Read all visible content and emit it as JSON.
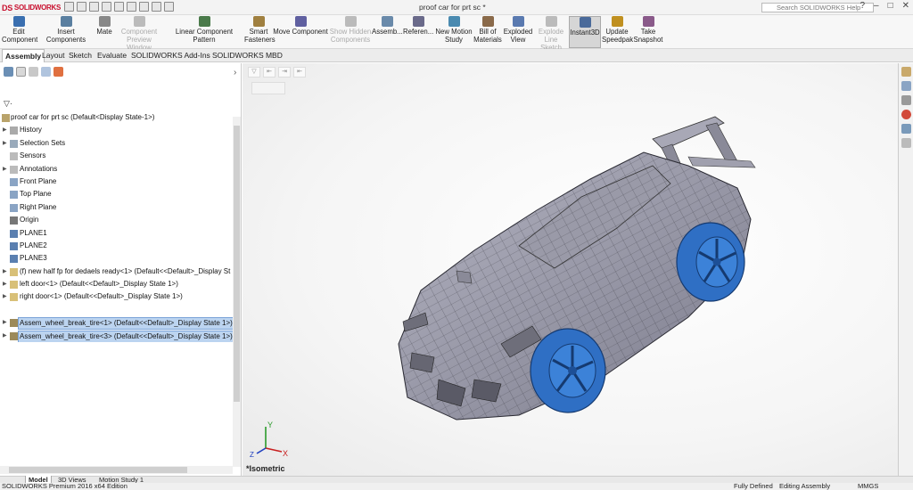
{
  "app": {
    "logo": "SOLIDWORKS",
    "window_title": "proof car for prt sc *",
    "search_placeholder": "Search SOLIDWORKS Help",
    "controls": [
      "?",
      "–",
      "□",
      "✕"
    ]
  },
  "ribbon": [
    {
      "label": "Edit Component",
      "state": "normal",
      "color": "#3a6fb0"
    },
    {
      "label": "Insert Components",
      "state": "normal",
      "color": "#5a7fa0"
    },
    {
      "label": "Mate",
      "state": "normal",
      "color": "#888888"
    },
    {
      "label": "Component Preview Window",
      "state": "disabled",
      "color": "#bbbbbb"
    },
    {
      "label": "Linear Component Pattern",
      "state": "normal",
      "color": "#4a7a4a"
    },
    {
      "label": "Smart Fasteners",
      "state": "normal",
      "color": "#a08040"
    },
    {
      "label": "Move Component",
      "state": "normal",
      "color": "#6060a0"
    },
    {
      "label": "Show Hidden Components",
      "state": "disabled",
      "color": "#bbbbbb"
    },
    {
      "label": "Assemb...",
      "state": "normal",
      "color": "#6a8aaa"
    },
    {
      "label": "Referen...",
      "state": "normal",
      "color": "#6a6a8a"
    },
    {
      "label": "New Motion Study",
      "state": "normal",
      "color": "#4a8ab0"
    },
    {
      "label": "Bill of Materials",
      "state": "normal",
      "color": "#8a6a4a"
    },
    {
      "label": "Exploded View",
      "state": "normal",
      "color": "#5a7ab0"
    },
    {
      "label": "Explode Line Sketch",
      "state": "disabled",
      "color": "#bbbbbb"
    },
    {
      "label": "Instant3D",
      "state": "active",
      "color": "#4a6a9a"
    },
    {
      "label": "Update Speedpak",
      "state": "normal",
      "color": "#c09020"
    },
    {
      "label": "Take Snapshot",
      "state": "normal",
      "color": "#8a5a8a"
    }
  ],
  "tabs": [
    {
      "label": "Assembly",
      "selected": true
    },
    {
      "label": "Layout",
      "selected": false
    },
    {
      "label": "Sketch",
      "selected": false
    },
    {
      "label": "Evaluate",
      "selected": false
    },
    {
      "label": "SOLIDWORKS Add-Ins",
      "selected": false
    },
    {
      "label": "SOLIDWORKS MBD",
      "selected": false
    }
  ],
  "tree": [
    {
      "label": "proof car for prt sc  (Default<Display State-1>)",
      "icon": "assembly-icon",
      "expander": false,
      "selected": false
    },
    {
      "label": "History",
      "icon": "history-icon",
      "expander": true,
      "selected": false
    },
    {
      "label": "Selection Sets",
      "icon": "selection-sets-icon",
      "expander": true,
      "selected": false
    },
    {
      "label": "Sensors",
      "icon": "sensors-icon",
      "expander": false,
      "selected": false
    },
    {
      "label": "Annotations",
      "icon": "annotations-icon",
      "expander": true,
      "selected": false
    },
    {
      "label": "Front Plane",
      "icon": "plane-icon",
      "expander": false,
      "selected": false
    },
    {
      "label": "Top Plane",
      "icon": "plane-icon",
      "expander": false,
      "selected": false
    },
    {
      "label": "Right Plane",
      "icon": "plane-icon",
      "expander": false,
      "selected": false
    },
    {
      "label": "Origin",
      "icon": "origin-icon",
      "expander": false,
      "selected": false
    },
    {
      "label": "PLANE1",
      "icon": "plane-icon",
      "expander": false,
      "selected": false
    },
    {
      "label": "PLANE2",
      "icon": "plane-icon",
      "expander": false,
      "selected": false
    },
    {
      "label": "PLANE3",
      "icon": "plane-icon",
      "expander": false,
      "selected": false
    },
    {
      "label": "(f) new half fp for dedaels ready<1> (Default<<Default>_Display St",
      "icon": "part-icon",
      "expander": true,
      "selected": false
    },
    {
      "label": "left door<1> (Default<<Default>_Display State 1>)",
      "icon": "part-icon",
      "expander": true,
      "selected": false
    },
    {
      "label": "right door<1> (Default<<Default>_Display State 1>)",
      "icon": "part-icon",
      "expander": true,
      "selected": false
    },
    {
      "label": "",
      "icon": "",
      "expander": false,
      "selected": false
    },
    {
      "label": "Assem_wheel_break_tire<1> (Default<<Default>_Display State 1>)",
      "icon": "subassembly-icon",
      "expander": true,
      "selected": true
    },
    {
      "label": "Assem_wheel_break_tire<3> (Default<<Default>_Display State 1>)",
      "icon": "subassembly-icon",
      "expander": true,
      "selected": true
    }
  ],
  "view": {
    "name": "*Isometric",
    "triad": {
      "x": "X",
      "y": "Y",
      "z": "Z"
    },
    "colors": {
      "wheel": "#2f6fc4",
      "body": "#8e8e9e",
      "mesh": "#3a3a44"
    }
  },
  "bottom_tabs": [
    {
      "label": "Model",
      "selected": true
    },
    {
      "label": "3D Views",
      "selected": false
    },
    {
      "label": "Motion Study 1",
      "selected": false
    }
  ],
  "status": {
    "edition": "SOLIDWORKS Premium 2016 x64 Edition",
    "defined": "Fully Defined",
    "mode": "Editing Assembly",
    "units": "MMGS"
  }
}
